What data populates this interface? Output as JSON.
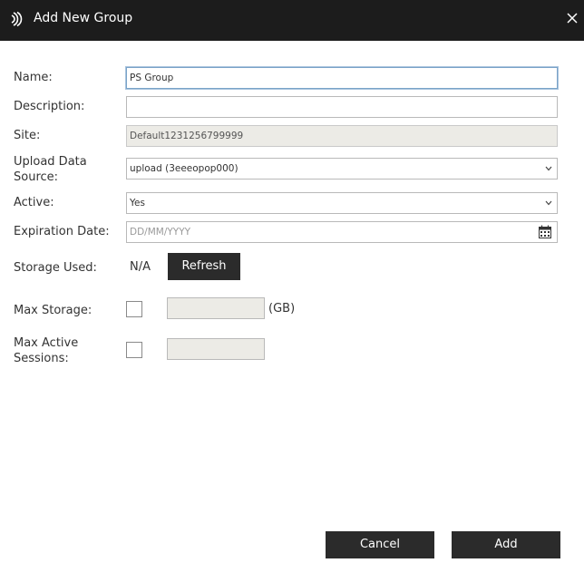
{
  "dialog": {
    "title": "Add New Group",
    "close_icon": "close-icon",
    "logo_icon": "app-logo-icon"
  },
  "form": {
    "name": {
      "label": "Name:",
      "value": "PS Group"
    },
    "description": {
      "label": "Description:",
      "value": ""
    },
    "site": {
      "label": "Site:",
      "value": "Default1231256799999"
    },
    "upload_source": {
      "label_line1": "Upload Data",
      "label_line2": "Source:",
      "value": "upload (3eeeopop000)"
    },
    "active": {
      "label": "Active:",
      "value": "Yes"
    },
    "expiration": {
      "label": "Expiration Date:",
      "placeholder": "DD/MM/YYYY",
      "icon": "calendar-icon"
    },
    "storage_used": {
      "label": "Storage Used:",
      "value": "N/A",
      "refresh_label": "Refresh"
    },
    "max_storage": {
      "label": "Max Storage:",
      "checked": false,
      "value": "",
      "unit": "(GB)"
    },
    "max_sessions": {
      "label_line1": "Max Active",
      "label_line2": "Sessions:",
      "checked": false,
      "value": ""
    }
  },
  "footer": {
    "cancel_label": "Cancel",
    "add_label": "Add"
  },
  "colors": {
    "titlebar": "#1c1c1c",
    "button": "#2b2b2b",
    "disabled_field": "#ecebe6",
    "focus_border": "#7aa3c8"
  }
}
